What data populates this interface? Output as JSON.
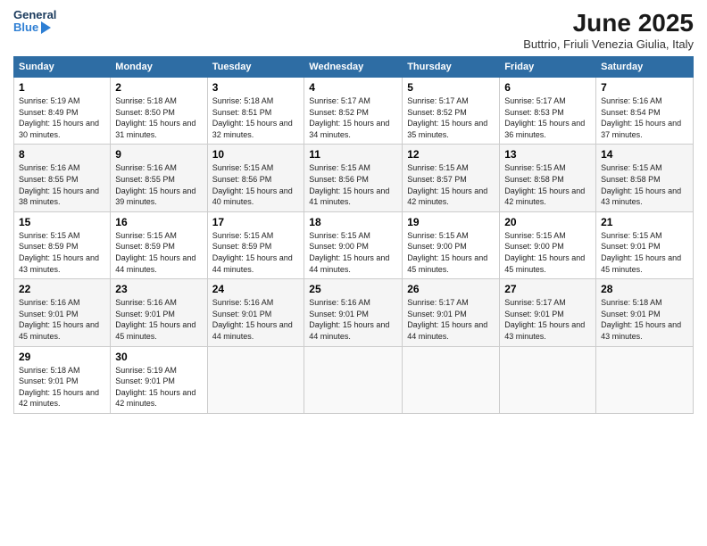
{
  "logo": {
    "general": "General",
    "blue": "Blue"
  },
  "title": "June 2025",
  "subtitle": "Buttrio, Friuli Venezia Giulia, Italy",
  "headers": [
    "Sunday",
    "Monday",
    "Tuesday",
    "Wednesday",
    "Thursday",
    "Friday",
    "Saturday"
  ],
  "weeks": [
    [
      {
        "day": "1",
        "sunrise": "Sunrise: 5:19 AM",
        "sunset": "Sunset: 8:49 PM",
        "daylight": "Daylight: 15 hours and 30 minutes."
      },
      {
        "day": "2",
        "sunrise": "Sunrise: 5:18 AM",
        "sunset": "Sunset: 8:50 PM",
        "daylight": "Daylight: 15 hours and 31 minutes."
      },
      {
        "day": "3",
        "sunrise": "Sunrise: 5:18 AM",
        "sunset": "Sunset: 8:51 PM",
        "daylight": "Daylight: 15 hours and 32 minutes."
      },
      {
        "day": "4",
        "sunrise": "Sunrise: 5:17 AM",
        "sunset": "Sunset: 8:52 PM",
        "daylight": "Daylight: 15 hours and 34 minutes."
      },
      {
        "day": "5",
        "sunrise": "Sunrise: 5:17 AM",
        "sunset": "Sunset: 8:52 PM",
        "daylight": "Daylight: 15 hours and 35 minutes."
      },
      {
        "day": "6",
        "sunrise": "Sunrise: 5:17 AM",
        "sunset": "Sunset: 8:53 PM",
        "daylight": "Daylight: 15 hours and 36 minutes."
      },
      {
        "day": "7",
        "sunrise": "Sunrise: 5:16 AM",
        "sunset": "Sunset: 8:54 PM",
        "daylight": "Daylight: 15 hours and 37 minutes."
      }
    ],
    [
      {
        "day": "8",
        "sunrise": "Sunrise: 5:16 AM",
        "sunset": "Sunset: 8:55 PM",
        "daylight": "Daylight: 15 hours and 38 minutes."
      },
      {
        "day": "9",
        "sunrise": "Sunrise: 5:16 AM",
        "sunset": "Sunset: 8:55 PM",
        "daylight": "Daylight: 15 hours and 39 minutes."
      },
      {
        "day": "10",
        "sunrise": "Sunrise: 5:15 AM",
        "sunset": "Sunset: 8:56 PM",
        "daylight": "Daylight: 15 hours and 40 minutes."
      },
      {
        "day": "11",
        "sunrise": "Sunrise: 5:15 AM",
        "sunset": "Sunset: 8:56 PM",
        "daylight": "Daylight: 15 hours and 41 minutes."
      },
      {
        "day": "12",
        "sunrise": "Sunrise: 5:15 AM",
        "sunset": "Sunset: 8:57 PM",
        "daylight": "Daylight: 15 hours and 42 minutes."
      },
      {
        "day": "13",
        "sunrise": "Sunrise: 5:15 AM",
        "sunset": "Sunset: 8:58 PM",
        "daylight": "Daylight: 15 hours and 42 minutes."
      },
      {
        "day": "14",
        "sunrise": "Sunrise: 5:15 AM",
        "sunset": "Sunset: 8:58 PM",
        "daylight": "Daylight: 15 hours and 43 minutes."
      }
    ],
    [
      {
        "day": "15",
        "sunrise": "Sunrise: 5:15 AM",
        "sunset": "Sunset: 8:59 PM",
        "daylight": "Daylight: 15 hours and 43 minutes."
      },
      {
        "day": "16",
        "sunrise": "Sunrise: 5:15 AM",
        "sunset": "Sunset: 8:59 PM",
        "daylight": "Daylight: 15 hours and 44 minutes."
      },
      {
        "day": "17",
        "sunrise": "Sunrise: 5:15 AM",
        "sunset": "Sunset: 8:59 PM",
        "daylight": "Daylight: 15 hours and 44 minutes."
      },
      {
        "day": "18",
        "sunrise": "Sunrise: 5:15 AM",
        "sunset": "Sunset: 9:00 PM",
        "daylight": "Daylight: 15 hours and 44 minutes."
      },
      {
        "day": "19",
        "sunrise": "Sunrise: 5:15 AM",
        "sunset": "Sunset: 9:00 PM",
        "daylight": "Daylight: 15 hours and 45 minutes."
      },
      {
        "day": "20",
        "sunrise": "Sunrise: 5:15 AM",
        "sunset": "Sunset: 9:00 PM",
        "daylight": "Daylight: 15 hours and 45 minutes."
      },
      {
        "day": "21",
        "sunrise": "Sunrise: 5:15 AM",
        "sunset": "Sunset: 9:01 PM",
        "daylight": "Daylight: 15 hours and 45 minutes."
      }
    ],
    [
      {
        "day": "22",
        "sunrise": "Sunrise: 5:16 AM",
        "sunset": "Sunset: 9:01 PM",
        "daylight": "Daylight: 15 hours and 45 minutes."
      },
      {
        "day": "23",
        "sunrise": "Sunrise: 5:16 AM",
        "sunset": "Sunset: 9:01 PM",
        "daylight": "Daylight: 15 hours and 45 minutes."
      },
      {
        "day": "24",
        "sunrise": "Sunrise: 5:16 AM",
        "sunset": "Sunset: 9:01 PM",
        "daylight": "Daylight: 15 hours and 44 minutes."
      },
      {
        "day": "25",
        "sunrise": "Sunrise: 5:16 AM",
        "sunset": "Sunset: 9:01 PM",
        "daylight": "Daylight: 15 hours and 44 minutes."
      },
      {
        "day": "26",
        "sunrise": "Sunrise: 5:17 AM",
        "sunset": "Sunset: 9:01 PM",
        "daylight": "Daylight: 15 hours and 44 minutes."
      },
      {
        "day": "27",
        "sunrise": "Sunrise: 5:17 AM",
        "sunset": "Sunset: 9:01 PM",
        "daylight": "Daylight: 15 hours and 43 minutes."
      },
      {
        "day": "28",
        "sunrise": "Sunrise: 5:18 AM",
        "sunset": "Sunset: 9:01 PM",
        "daylight": "Daylight: 15 hours and 43 minutes."
      }
    ],
    [
      {
        "day": "29",
        "sunrise": "Sunrise: 5:18 AM",
        "sunset": "Sunset: 9:01 PM",
        "daylight": "Daylight: 15 hours and 42 minutes."
      },
      {
        "day": "30",
        "sunrise": "Sunrise: 5:19 AM",
        "sunset": "Sunset: 9:01 PM",
        "daylight": "Daylight: 15 hours and 42 minutes."
      },
      null,
      null,
      null,
      null,
      null
    ]
  ]
}
